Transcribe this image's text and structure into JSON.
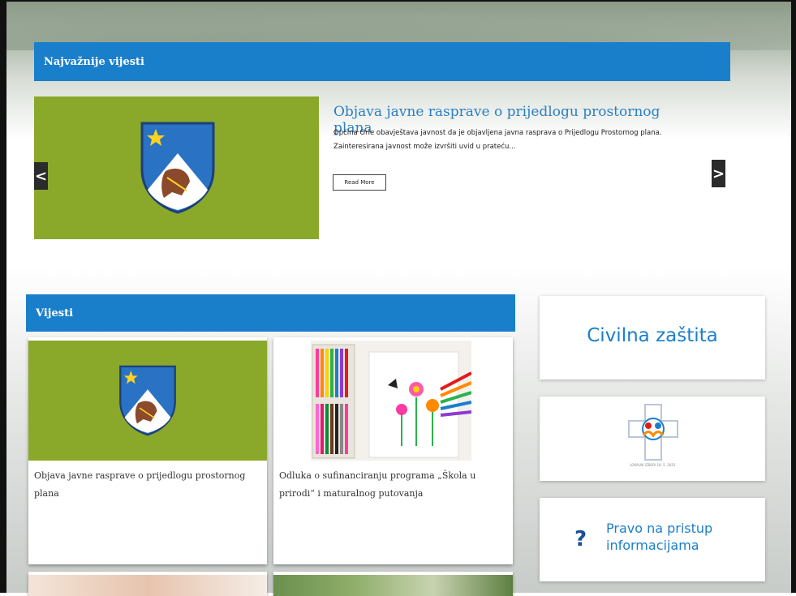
{
  "colors": {
    "accent": "#1a7fcb",
    "green": "#8aa82a",
    "arrow_bg": "#2b2b2b"
  },
  "featured": {
    "header": "Najvažnije vijesti",
    "slide": {
      "title": "Objava javne rasprave o prijedlogu prostornog plana",
      "excerpt": "Općina Orle obavještava javnost da je objavljena javna rasprava o Prijedlogu Prostornog plana. Zainteresirana javnost može izvršiti uvid u prateću...",
      "read_more": "Read More"
    },
    "prev_icon": "chevron-left-icon",
    "next_icon": "chevron-right-icon",
    "prev_label": "<",
    "next_label": ">"
  },
  "news": {
    "header": "Vijesti",
    "items": [
      {
        "title": "Objava javne rasprave o prijedlogu prostornog plana",
        "image": "coat-of-arms"
      },
      {
        "title": "Odluka o sufinanciranju programa „Škola u prirodi“ i maturalnog putovanja",
        "image": "markers-drawing"
      }
    ]
  },
  "sidebar": {
    "civilna": "Civilna zaštita",
    "logo_caption": "LOKALNI IZBORI 18. 5. 2025.",
    "pravo": "Pravo na pristup informacijama",
    "question_mark": "?"
  }
}
